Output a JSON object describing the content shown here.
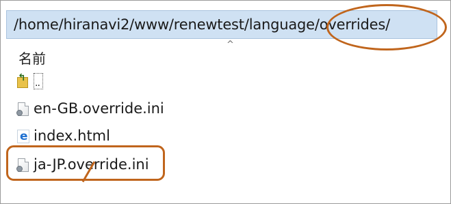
{
  "path_bar": {
    "text": "/home/hiranavi2/www/renewtest/language/overrides/"
  },
  "file_list": {
    "column_header": "名前",
    "sort_indicator": "^",
    "parent_entry": "..",
    "files": [
      {
        "name": "en-GB.override.ini",
        "icon": "ini-file-icon"
      },
      {
        "name": "index.html",
        "icon": "html-file-icon"
      },
      {
        "name": "ja-JP.override.ini",
        "icon": "ini-file-icon"
      }
    ]
  },
  "annotation_color": "#c0651c",
  "path_bar_color": "#cfe1f3"
}
